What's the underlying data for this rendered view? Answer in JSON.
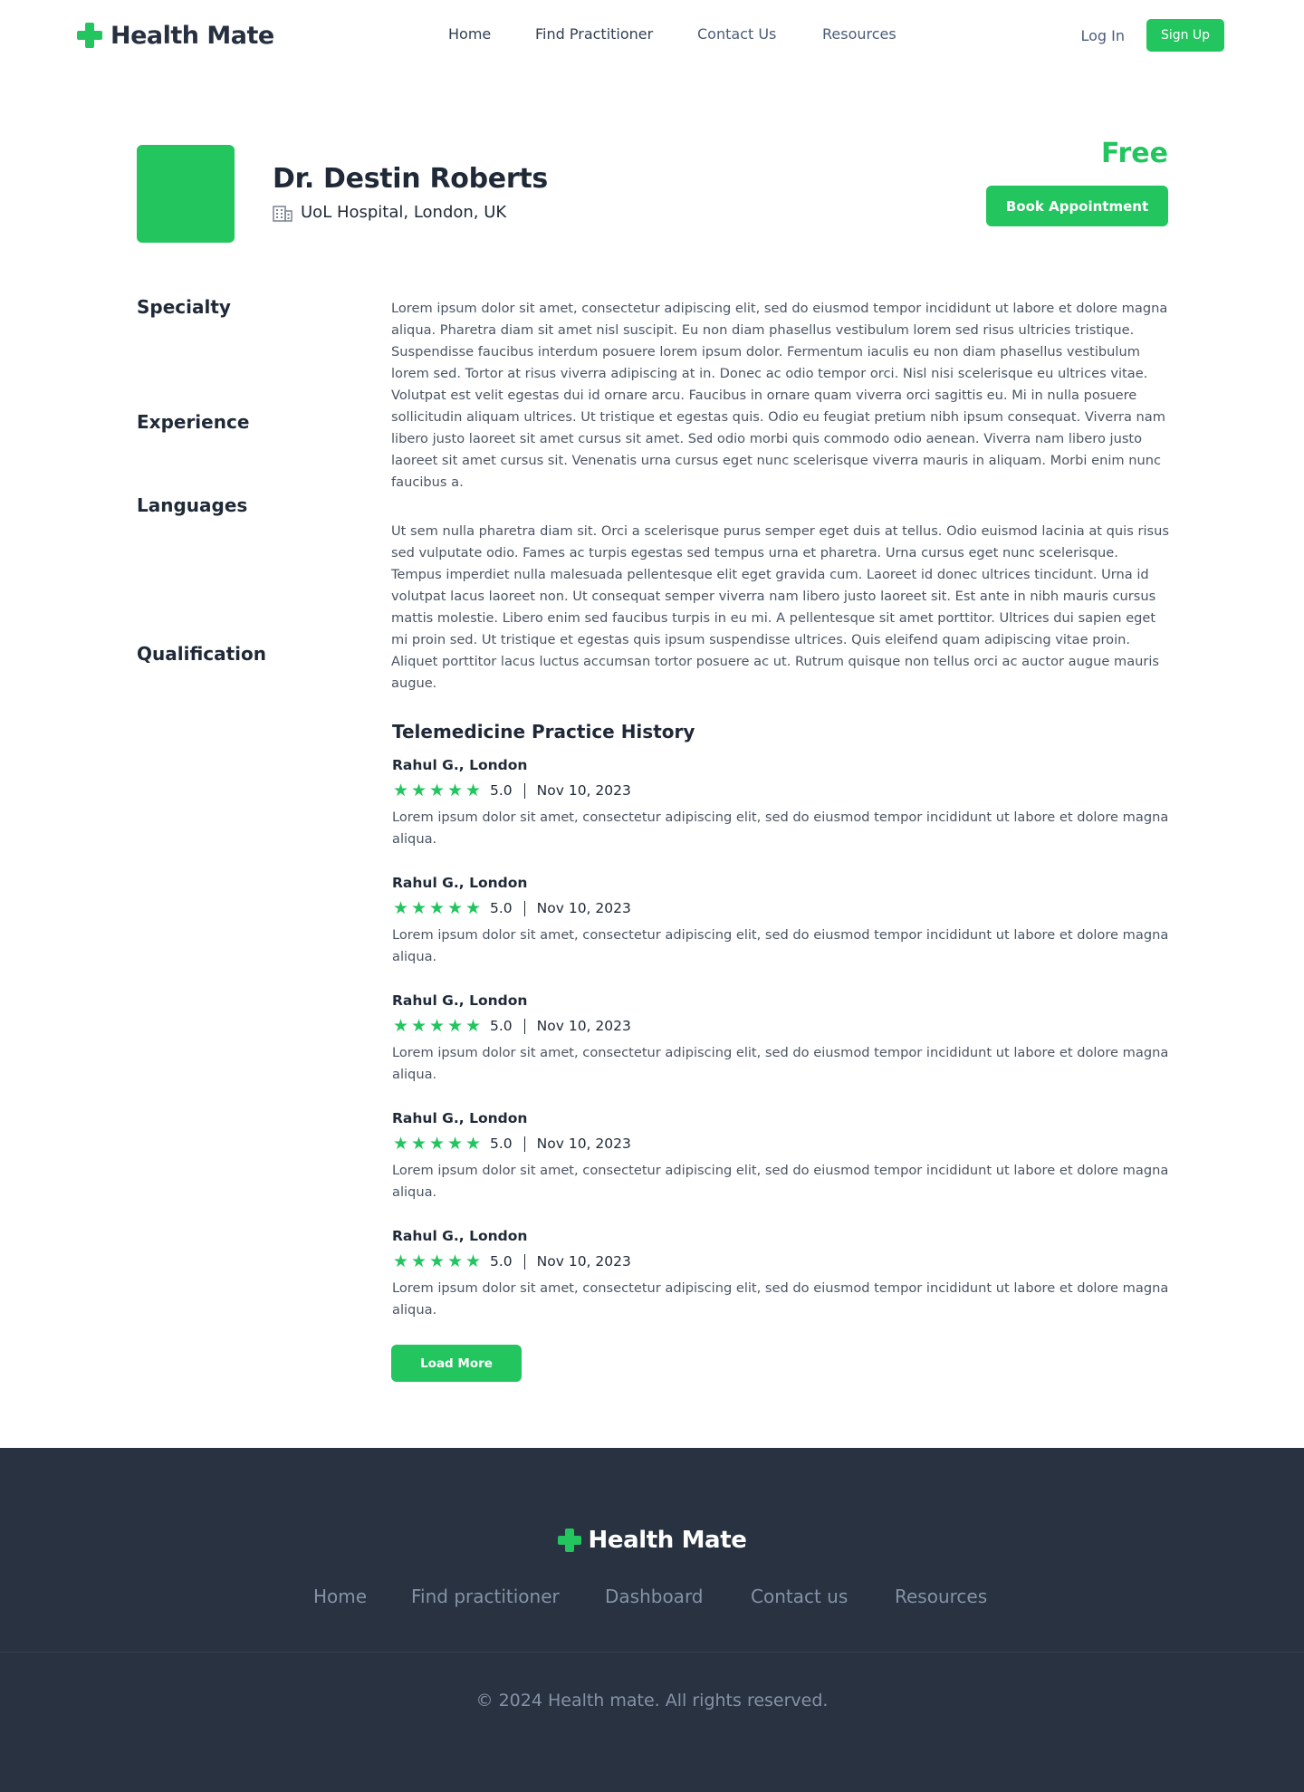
{
  "brand": {
    "name": "Health Mate",
    "accent_color": "#22c55e"
  },
  "nav": {
    "home": "Home",
    "find_practitioner": "Find Practitioner",
    "contact": "Contact Us",
    "resources": "Resources"
  },
  "auth": {
    "login": "Log In",
    "signup": "Sign Up"
  },
  "profile": {
    "name": "Dr. Destin Roberts",
    "hospital": "UoL Hospital, London, UK",
    "hospital_icon": "building-icon",
    "price": "Free",
    "book_label": "Book Appointment"
  },
  "sections": {
    "specialty": "Specialty",
    "experience": "Experience",
    "languages": "Languages",
    "qualification": "Qualification"
  },
  "about": {
    "paragraph1": "Lorem ipsum dolor sit amet, consectetur adipiscing elit, sed do eiusmod tempor incididunt ut labore et dolore magna aliqua. Pharetra diam sit amet nisl suscipit. Eu non diam phasellus vestibulum lorem sed risus ultricies tristique. Suspendisse faucibus interdum posuere lorem ipsum dolor. Fermentum iaculis eu non diam phasellus vestibulum lorem sed. Tortor at risus viverra adipiscing at in. Donec ac odio tempor orci. Nisl nisi scelerisque eu ultrices vitae. Volutpat est velit egestas dui id ornare arcu. Faucibus in ornare quam viverra orci sagittis eu. Mi in nulla posuere sollicitudin aliquam ultrices. Ut tristique et egestas quis. Odio eu feugiat pretium nibh ipsum consequat. Viverra nam libero justo laoreet sit amet cursus sit amet. Sed odio morbi quis commodo odio aenean. Viverra nam libero justo laoreet sit amet cursus sit. Venenatis urna cursus eget nunc scelerisque viverra mauris in aliquam. Morbi enim nunc faucibus a.",
    "paragraph2": "Ut sem nulla pharetra diam sit. Orci a scelerisque purus semper eget duis at tellus. Odio euismod lacinia at quis risus sed vulputate odio. Fames ac turpis egestas sed tempus urna et pharetra. Urna cursus eget nunc scelerisque. Tempus imperdiet nulla malesuada pellentesque elit eget gravida cum. Laoreet id donec ultrices tincidunt. Urna id volutpat lacus laoreet non. Ut consequat semper viverra nam libero justo laoreet sit. Est ante in nibh mauris cursus mattis molestie. Libero enim sed faucibus turpis in eu mi. A pellentesque sit amet porttitor. Ultrices dui sapien eget mi proin sed. Ut tristique et egestas quis ipsum suspendisse ultrices. Quis eleifend quam adipiscing vitae proin. Aliquet porttitor lacus luctus accumsan tortor posuere ac ut. Rutrum quisque non tellus orci ac auctor augue mauris augue."
  },
  "history": {
    "title": "Telemedicine Practice History",
    "reviews": [
      {
        "reviewer": "Rahul G., London",
        "stars": 5,
        "rating": "5.0",
        "date": "Nov 10, 2023",
        "text": "Lorem ipsum dolor sit amet, consectetur adipiscing elit, sed do eiusmod tempor incididunt ut labore et dolore magna aliqua."
      },
      {
        "reviewer": "Rahul G., London",
        "stars": 5,
        "rating": "5.0",
        "date": "Nov 10, 2023",
        "text": "Lorem ipsum dolor sit amet, consectetur adipiscing elit, sed do eiusmod tempor incididunt ut labore et dolore magna aliqua."
      },
      {
        "reviewer": "Rahul G., London",
        "stars": 5,
        "rating": "5.0",
        "date": "Nov 10, 2023",
        "text": "Lorem ipsum dolor sit amet, consectetur adipiscing elit, sed do eiusmod tempor incididunt ut labore et dolore magna aliqua."
      },
      {
        "reviewer": "Rahul G., London",
        "stars": 5,
        "rating": "5.0",
        "date": "Nov 10, 2023",
        "text": "Lorem ipsum dolor sit amet, consectetur adipiscing elit, sed do eiusmod tempor incididunt ut labore et dolore magna aliqua."
      },
      {
        "reviewer": "Rahul G., London",
        "stars": 5,
        "rating": "5.0",
        "date": "Nov 10, 2023",
        "text": "Lorem ipsum dolor sit amet, consectetur adipiscing elit, sed do eiusmod tempor incididunt ut labore et dolore magna aliqua."
      }
    ],
    "load_more": "Load More"
  },
  "footer": {
    "brand": "Health Mate",
    "links": {
      "home": "Home",
      "find": "Find practitioner",
      "dashboard": "Dashboard",
      "contact": "Contact us",
      "resources": "Resources"
    },
    "copyright": "© 2024 Health mate. All rights reserved.",
    "background_color": "#283240"
  }
}
